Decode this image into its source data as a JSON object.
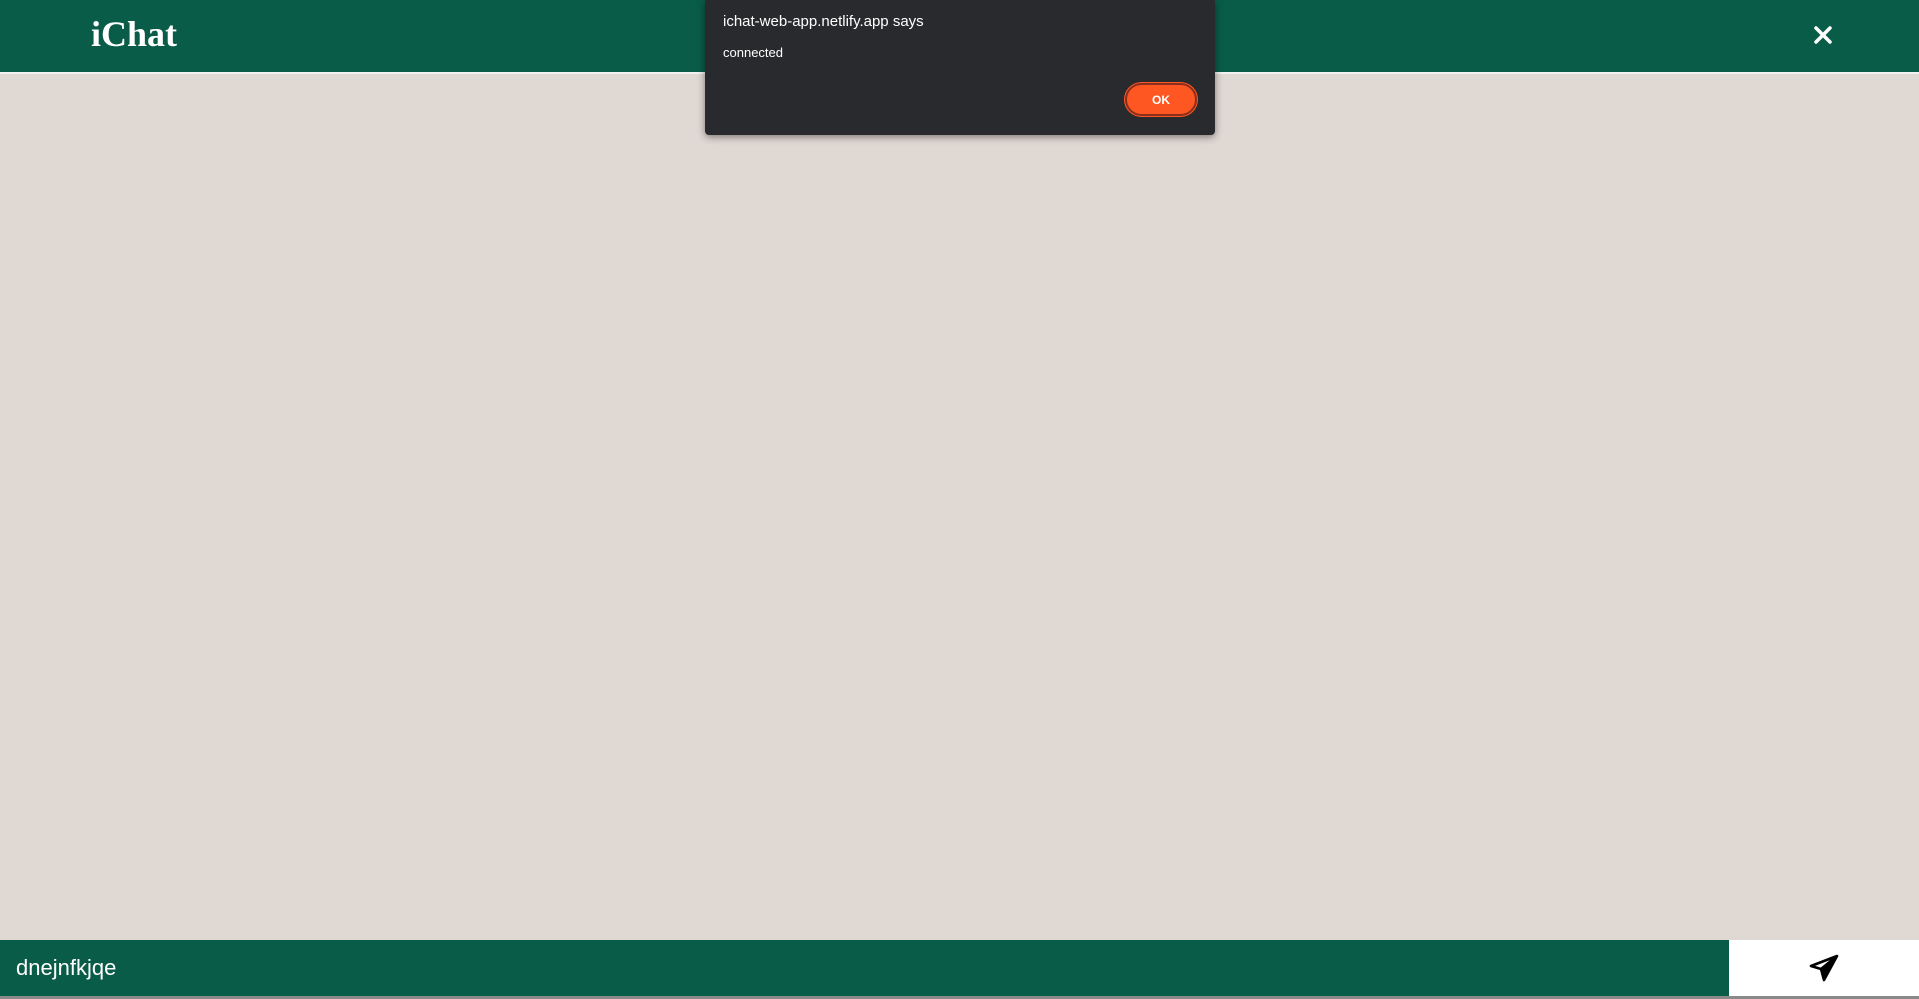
{
  "header": {
    "brand": "iChat",
    "close_icon": "close-icon"
  },
  "composer": {
    "message_value": "dnejnfkjqe",
    "send_icon": "send-paper-plane-icon"
  },
  "alert_dialog": {
    "title": "ichat-web-app.netlify.app says",
    "message": "connected",
    "ok_label": "OK"
  },
  "colors": {
    "header_bg": "#095c47",
    "chat_bg": "#e0d8d3",
    "dialog_bg": "#292a2d",
    "ok_button": "#ff5722",
    "send_button_bg": "#ffffff"
  }
}
